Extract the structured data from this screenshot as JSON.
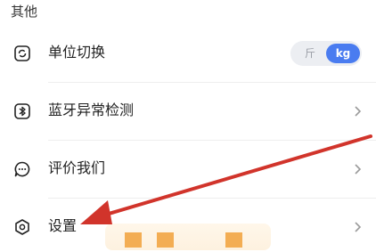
{
  "section": {
    "title": "其他"
  },
  "rows": [
    {
      "label": "单位切换",
      "icon": "unit-switch-icon"
    },
    {
      "label": "蓝牙异常检测",
      "icon": "bluetooth-icon"
    },
    {
      "label": "评价我们",
      "icon": "chat-bubble-icon"
    },
    {
      "label": "设置",
      "icon": "settings-hexagon-icon"
    }
  ],
  "unit_toggle": {
    "options": [
      "斤",
      "kg"
    ],
    "selected": "kg"
  },
  "colors": {
    "accent": "#4a7cf0",
    "annotation_arrow": "#d1342b",
    "highlight": "#f3ad53"
  }
}
